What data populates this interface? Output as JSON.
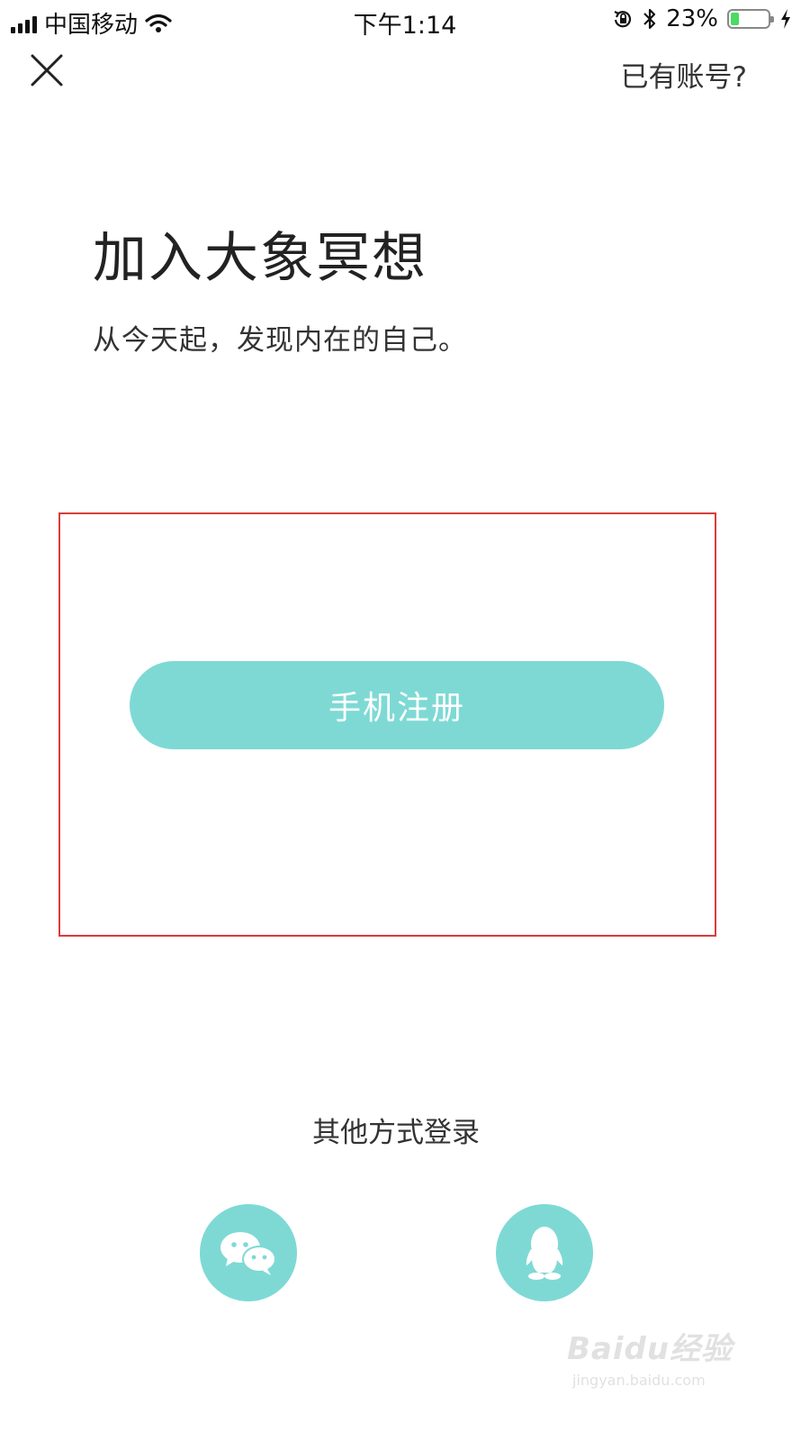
{
  "status_bar": {
    "carrier": "中国移动",
    "time": "下午1:14",
    "battery_percent": "23%",
    "battery_level": 0.23,
    "icons": [
      "signal-icon",
      "wifi-icon",
      "orientation-lock-icon",
      "bluetooth-icon",
      "battery-icon",
      "charging-icon"
    ]
  },
  "nav": {
    "close_icon": "close-icon",
    "login_link": "已有账号?"
  },
  "header": {
    "title": "加入大象冥想",
    "subtitle": "从今天起，发现内在的自己。"
  },
  "register": {
    "button_label": "手机注册"
  },
  "other_login": {
    "title": "其他方式登录",
    "options": [
      {
        "icon": "wechat-icon"
      },
      {
        "icon": "qq-icon"
      }
    ]
  },
  "watermark": {
    "brand": "Baidu经验",
    "url": "jingyan.baidu.com"
  },
  "colors": {
    "accent": "#7ed9d4",
    "highlight_border": "#d93c3c",
    "battery_fill": "#4cd964"
  }
}
